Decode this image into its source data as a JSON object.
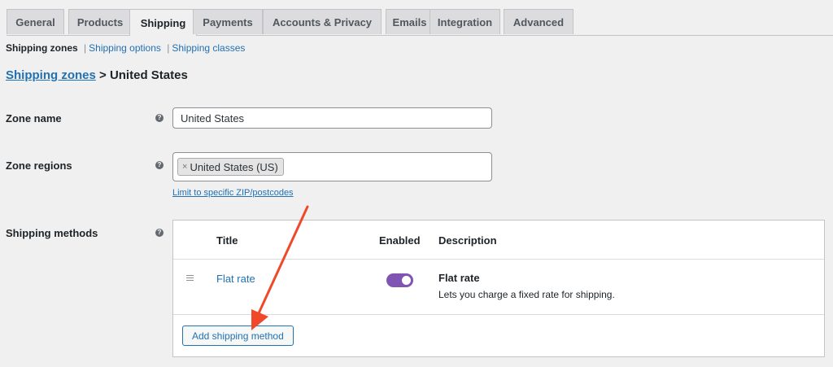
{
  "tabs": [
    {
      "label": "General"
    },
    {
      "label": "Products"
    },
    {
      "label": "Shipping",
      "active": true
    },
    {
      "label": "Payments"
    },
    {
      "label": "Accounts & Privacy"
    },
    {
      "label": "Emails"
    },
    {
      "label": "Integration"
    },
    {
      "label": "Advanced"
    }
  ],
  "subnav": {
    "current": "Shipping zones",
    "options": "Shipping options",
    "classes": "Shipping classes",
    "separator": "|"
  },
  "heading": {
    "link": "Shipping zones",
    "rest": " > United States"
  },
  "fields": {
    "zone_name": {
      "label": "Zone name",
      "value": "United States"
    },
    "zone_regions": {
      "label": "Zone regions",
      "chip": "United States (US)",
      "chip_remove": "×",
      "limit_link": "Limit to specific ZIP/postcodes"
    },
    "shipping_methods": {
      "label": "Shipping methods"
    }
  },
  "help_icon": "?",
  "methods_table": {
    "columns": {
      "title": "Title",
      "enabled": "Enabled",
      "description": "Description"
    },
    "rows": [
      {
        "title": "Flat rate",
        "enabled": true,
        "desc_title": "Flat rate",
        "desc_text": "Lets you charge a fixed rate for shipping."
      }
    ],
    "add_button": "Add shipping method"
  },
  "colors": {
    "accent": "#2271b1",
    "toggle_on": "#7f54b3",
    "arrow": "#f0492a"
  },
  "icons": {
    "drag": "drag-handle-icon",
    "help": "help-icon",
    "arrow": "annotation-arrow"
  }
}
